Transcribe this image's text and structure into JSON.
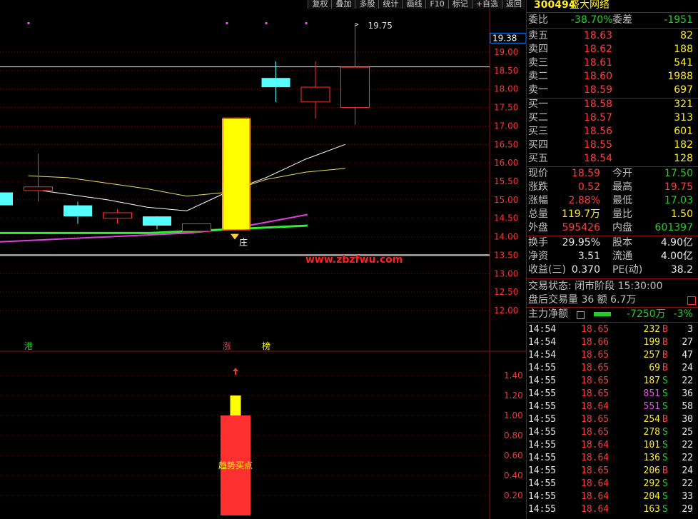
{
  "toolbar": {
    "buttons": [
      "复权",
      "叠加",
      "多股",
      "统计",
      "画线",
      "F10",
      "标记",
      "+自选",
      "返回"
    ]
  },
  "stock": {
    "code": "300494",
    "name": "盛大网络"
  },
  "order_book": {
    "weibi_label": "委比",
    "weibi": "-38.70%",
    "weicha_label": "委差",
    "weicha": "-1951",
    "asks": [
      {
        "label": "卖五",
        "price": "18.63",
        "vol": "82"
      },
      {
        "label": "卖四",
        "price": "18.62",
        "vol": "188"
      },
      {
        "label": "卖三",
        "price": "18.61",
        "vol": "541"
      },
      {
        "label": "卖二",
        "price": "18.60",
        "vol": "1988"
      },
      {
        "label": "卖一",
        "price": "18.59",
        "vol": "697"
      }
    ],
    "bids": [
      {
        "label": "买一",
        "price": "18.58",
        "vol": "321"
      },
      {
        "label": "买二",
        "price": "18.57",
        "vol": "313"
      },
      {
        "label": "买三",
        "price": "18.56",
        "vol": "601"
      },
      {
        "label": "买四",
        "price": "18.55",
        "vol": "182"
      },
      {
        "label": "买五",
        "price": "18.54",
        "vol": "128"
      }
    ]
  },
  "quote": [
    {
      "l1": "现价",
      "v1": "18.59",
      "c1": "red",
      "l2": "今开",
      "v2": "17.50",
      "c2": "green"
    },
    {
      "l1": "涨跌",
      "v1": "0.52",
      "c1": "red",
      "l2": "最高",
      "v2": "19.75",
      "c2": "red"
    },
    {
      "l1": "涨幅",
      "v1": "2.88%",
      "c1": "red",
      "l2": "最低",
      "v2": "17.03",
      "c2": "green"
    },
    {
      "l1": "总量",
      "v1": "119.7万",
      "c1": "yellow",
      "l2": "量比",
      "v2": "1.50",
      "c2": "yellow"
    },
    {
      "l1": "外盘",
      "v1": "595426",
      "c1": "red",
      "l2": "内盘",
      "v2": "601397",
      "c2": "green"
    }
  ],
  "stats": [
    {
      "l1": "换手",
      "v1": "29.95%",
      "l2": "股本",
      "v2": "4.90亿"
    },
    {
      "l1": "净资",
      "v1": "3.51",
      "l2": "流通",
      "v2": "4.00亿"
    },
    {
      "l1": "收益(三)",
      "v1": "0.370",
      "l2": "PE(动)",
      "v2": "38.2"
    }
  ],
  "trade_status": {
    "line1": "交易状态: 闭市阶段 15:30:00",
    "line2": "盘后交易量 36 额 6.7万"
  },
  "main_flow": {
    "label": "主力净额",
    "value": "-7250万",
    "pct": "-3%"
  },
  "ticks": [
    {
      "time": "14:54",
      "price": "18.65",
      "vol": "232",
      "vc": "yellow",
      "side": "B",
      "n": "3"
    },
    {
      "time": "14:54",
      "price": "18.66",
      "vol": "199",
      "vc": "yellow",
      "side": "B",
      "n": "27"
    },
    {
      "time": "14:54",
      "price": "18.65",
      "vol": "257",
      "vc": "yellow",
      "side": "B",
      "n": "47"
    },
    {
      "time": "14:55",
      "price": "18.65",
      "vol": "69",
      "vc": "yellow",
      "side": "B",
      "n": "24"
    },
    {
      "time": "14:55",
      "price": "18.65",
      "vol": "187",
      "vc": "yellow",
      "side": "S",
      "n": "22"
    },
    {
      "time": "14:55",
      "price": "18.65",
      "vol": "851",
      "vc": "magenta",
      "side": "S",
      "n": "36"
    },
    {
      "time": "14:55",
      "price": "18.64",
      "vol": "551",
      "vc": "magenta",
      "side": "S",
      "n": "58"
    },
    {
      "time": "14:55",
      "price": "18.65",
      "vol": "254",
      "vc": "yellow",
      "side": "B",
      "n": "30"
    },
    {
      "time": "14:55",
      "price": "18.65",
      "vol": "278",
      "vc": "yellow",
      "side": "S",
      "n": "25"
    },
    {
      "time": "14:55",
      "price": "18.64",
      "vol": "101",
      "vc": "yellow",
      "side": "S",
      "n": "22"
    },
    {
      "time": "14:55",
      "price": "18.64",
      "vol": "136",
      "vc": "yellow",
      "side": "S",
      "n": "22"
    },
    {
      "time": "14:55",
      "price": "18.65",
      "vol": "206",
      "vc": "yellow",
      "side": "B",
      "n": "24"
    },
    {
      "time": "14:55",
      "price": "18.64",
      "vol": "292",
      "vc": "yellow",
      "side": "S",
      "n": "22"
    },
    {
      "time": "14:55",
      "price": "18.64",
      "vol": "204",
      "vc": "yellow",
      "side": "S",
      "n": "33"
    },
    {
      "time": "14:55",
      "price": "18.64",
      "vol": "163",
      "vc": "yellow",
      "side": "S",
      "n": "29"
    }
  ],
  "chart_data": [
    {
      "type": "candlestick",
      "ylim": [
        11.8,
        19.6
      ],
      "y_ticks": [
        12.0,
        12.5,
        13.0,
        13.5,
        14.0,
        14.5,
        15.0,
        15.5,
        16.0,
        16.5,
        17.0,
        17.5,
        18.0,
        18.5,
        19.0
      ],
      "y_tick_labels": [
        "12.00",
        "12.50",
        "13.00",
        "13.50",
        "14.00",
        "14.50",
        "15.00",
        "15.50",
        "16.00",
        "16.50",
        "17.00",
        "17.50",
        "18.00",
        "18.50",
        "19.00"
      ],
      "current_price_label": "19.38",
      "high_label": "19.75",
      "watermark": "www.zbzfwu.com",
      "marker_text": "庄",
      "reference_line": 13.5,
      "upper_line": 18.6,
      "candles": [
        {
          "o": 14.85,
          "h": 15.1,
          "l": 14.65,
          "c": 15.2,
          "color": "cyan"
        },
        {
          "o": 15.25,
          "h": 16.25,
          "l": 14.95,
          "c": 15.35,
          "color": "red"
        },
        {
          "o": 14.55,
          "h": 14.95,
          "l": 14.35,
          "c": 14.85,
          "color": "cyan"
        },
        {
          "o": 14.5,
          "h": 14.75,
          "l": 14.35,
          "c": 14.65,
          "color": "red"
        },
        {
          "o": 14.3,
          "h": 14.55,
          "l": 14.2,
          "c": 14.55,
          "color": "cyan"
        },
        {
          "o": 14.15,
          "h": 14.35,
          "l": 14.1,
          "c": 14.35,
          "color": "red"
        },
        {
          "o": 14.2,
          "h": 17.2,
          "l": 14.2,
          "c": 17.2,
          "color": "yellow"
        },
        {
          "o": 18.05,
          "h": 18.75,
          "l": 17.65,
          "c": 18.3,
          "color": "cyan"
        },
        {
          "o": 17.65,
          "h": 18.75,
          "l": 17.2,
          "c": 18.05,
          "color": "red"
        },
        {
          "o": 17.5,
          "h": 19.75,
          "l": 17.03,
          "c": 18.59,
          "color": "red"
        }
      ],
      "ma_white": [
        15.3,
        15.15,
        15.0,
        14.8,
        14.7,
        15.2,
        15.6,
        16.1,
        16.5
      ],
      "ma_yellow": [
        15.65,
        15.6,
        15.45,
        15.3,
        15.1,
        15.2,
        15.55,
        15.75,
        15.85
      ],
      "ma_magenta": [
        13.85,
        13.9,
        13.95,
        14.0,
        14.05,
        14.1,
        14.2,
        14.4,
        14.6
      ],
      "ma_green": [
        14.1,
        14.1,
        14.1,
        14.1,
        14.1,
        14.15,
        14.2,
        14.25,
        14.3
      ]
    },
    {
      "type": "bar",
      "ylim": [
        0,
        1.6
      ],
      "y_ticks": [
        0.2,
        0.4,
        0.6,
        0.8,
        1.0,
        1.2,
        1.4
      ],
      "y_tick_labels": [
        "0.20",
        "0.40",
        "0.60",
        "0.80",
        "1.00",
        "1.20",
        "1.40"
      ],
      "bars": [
        {
          "x_index": 6,
          "base": 0,
          "value": 1.0,
          "color": "red"
        },
        {
          "x_index": 6,
          "base": 1.0,
          "value": 1.2,
          "color": "yellow"
        }
      ],
      "annotation": "趋势买点",
      "separator_labels": [
        {
          "text": "港",
          "x_index": 0,
          "color": "green"
        },
        {
          "text": "涨",
          "x_index": 6,
          "color": "red"
        },
        {
          "text": "榜",
          "x_index": 7,
          "color": "yellow"
        }
      ]
    }
  ]
}
